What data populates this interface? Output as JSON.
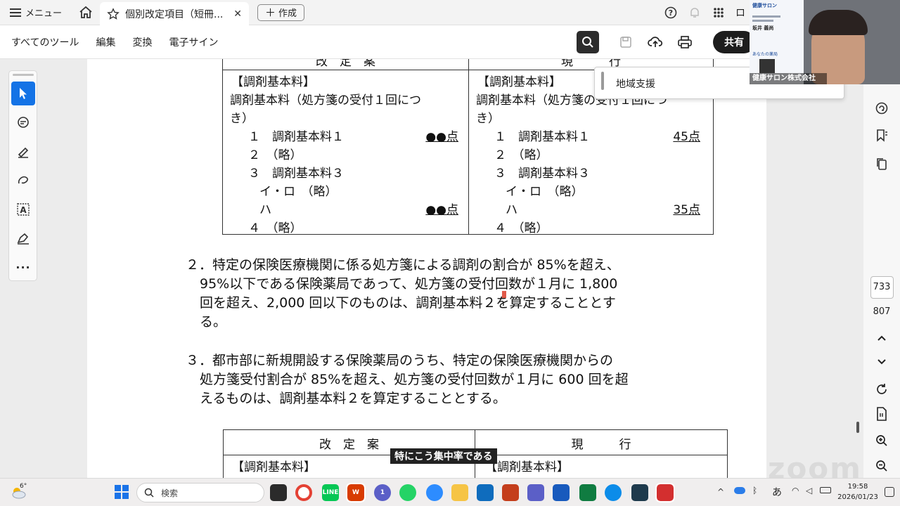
{
  "topbar": {
    "menu_label": "メニュー",
    "tab_title": "個別改定項目（短冊...",
    "new_label": "作成",
    "login_label": "ロ"
  },
  "toolbar": {
    "items": [
      "すべてのツール",
      "編集",
      "変換",
      "電子サイン"
    ],
    "share_label": "共有"
  },
  "table1": {
    "header_left": "改　定　案",
    "header_right": "現　　　行",
    "left": {
      "l1": "【調剤基本料】",
      "l2": "調剤基本料（処方箋の受付１回につ",
      "l3": "き）",
      "i1": "１　調剤基本料１",
      "i1_pts": "●●点",
      "i2": "２　（略）",
      "i3": "３　調剤基本料３",
      "i3a": "イ・ロ　（略）",
      "i3b": "ハ",
      "i3b_pts": "●●点",
      "i4": "４　（略）"
    },
    "right": {
      "l1": "【調剤基本料】",
      "l2": "調剤基本料（処方箋の受付１回につ",
      "l3": "き）",
      "i1": "１　調剤基本料１",
      "i1_pts": "45点",
      "i2": "２　（略）",
      "i3": "３　調剤基本料３",
      "i3a": "イ・ロ　（略）",
      "i3b": "ハ",
      "i3b_pts": "35点",
      "i4": "４　（略）"
    }
  },
  "para2": {
    "l1": "２．特定の保険医療機関に係る処方箋による調剤の割合が 85%を超え、",
    "l2": "95%以下である保険薬局であって、処方箋の受付回数が１月に 1,800",
    "l3": "回を超え、2,000 回以下のものは、調剤基本料２を算定することとす",
    "l4": "る。"
  },
  "para3": {
    "l1": "３．都市部に新規開設する保険薬局のうち、特定の保険医療機関からの",
    "l2": "処方箋受付割合が 85%を超え、処方箋の受付回数が１月に 600 回を超",
    "l3": "えるものは、調剤基本料２を算定することとする。"
  },
  "table2": {
    "header_left": "改　定　案",
    "header_right": "現　　　行",
    "left_l1": "【調剤基本料】",
    "right_l1": "【調剤基本料】"
  },
  "popup": {
    "text": "地域支援"
  },
  "webcam": {
    "badge_title": "健康サロン",
    "name": "坂井 義尚",
    "company": "健康サロン株式会社",
    "pharmacy": "あなたの薬局"
  },
  "caption": "特にこう集中率である",
  "watermark": "zoom",
  "page_numbers": {
    "current": "733",
    "total": "807"
  },
  "taskbar": {
    "search_placeholder": "検索",
    "time": "19:58",
    "date": "2026/01/23",
    "temp": "6°",
    "ime": "あ",
    "notif_count": "1"
  },
  "colors": {
    "accent": "#1473e6",
    "share": "#1d1d1d",
    "pdf_red": "#d32f2f"
  }
}
